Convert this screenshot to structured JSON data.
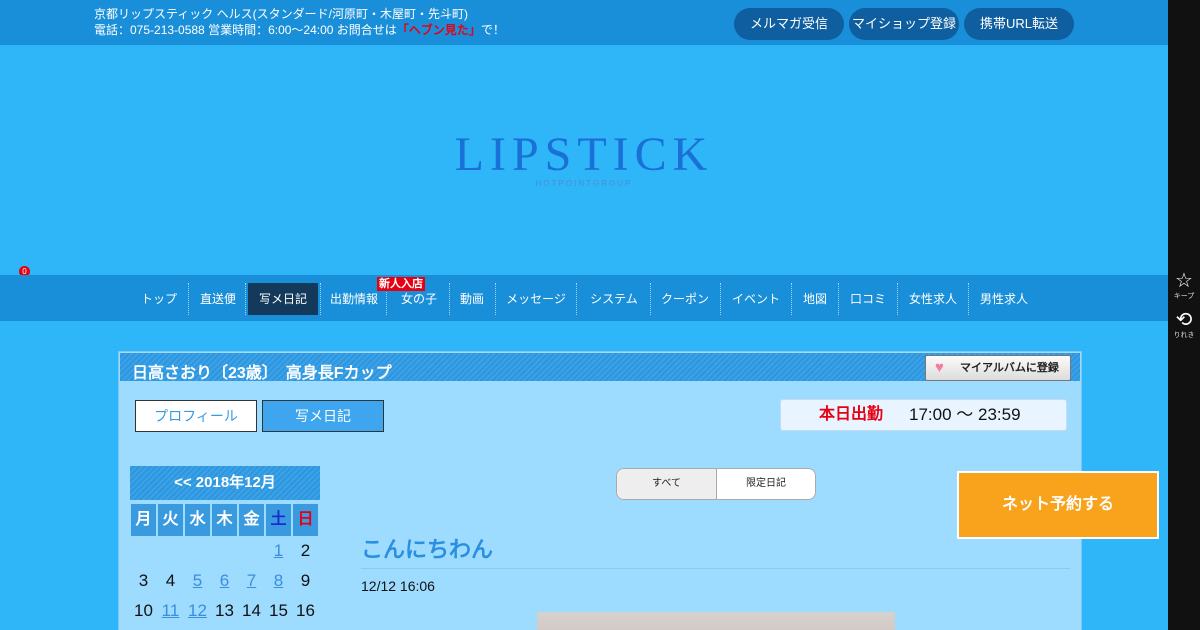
{
  "topbar": {
    "line1": "京都リップスティック ヘルス(スタンダード/河原町・木屋町・先斗町)",
    "line2_prefix": "電話：075-213-0588 営業時間：6:00～24:00 お問合せは",
    "line2_highlight": "「ヘブン見た」",
    "line2_suffix": "で！",
    "buttons": [
      "メルマガ受信",
      "マイショップ登録",
      "携帯URL転送"
    ]
  },
  "side": {
    "keep_label": "キープ",
    "keep_count": "0",
    "history_label": "りれき"
  },
  "logo": {
    "main": "LIPSTICK",
    "sub": "HOTPOINTGROUP"
  },
  "nav": {
    "items": [
      "トップ",
      "直送便",
      "写メ日記",
      "出勤情報",
      "女の子",
      "動画",
      "メッセージ",
      "システム",
      "クーポン",
      "イベント",
      "地図",
      "口コミ",
      "女性求人",
      "男性求人"
    ],
    "active": "写メ日記",
    "new_badge": "新人入店"
  },
  "profile": {
    "title": "日高さおり〔23歳〕　高身長Fカップ",
    "album_button": "マイアルバムに登録",
    "tabs": [
      "プロフィール",
      "写メ日記"
    ],
    "schedule_label": "本日出勤",
    "schedule_time": "17:00 ～ 23:59"
  },
  "calendar": {
    "header": "<< 2018年12月",
    "weekdays": [
      "月",
      "火",
      "水",
      "木",
      "金",
      "土",
      "日"
    ],
    "rows": [
      [
        "",
        "",
        "",
        "",
        "",
        "1",
        "2"
      ],
      [
        "3",
        "4",
        "5",
        "6",
        "7",
        "8",
        "9"
      ],
      [
        "10",
        "11",
        "12",
        "13",
        "14",
        "15",
        "16"
      ]
    ],
    "linked_days": [
      "1",
      "5",
      "6",
      "7",
      "8",
      "11",
      "12"
    ]
  },
  "diary": {
    "filter_all": "すべて",
    "filter_limited": "限定日記",
    "post_title": "こんにちわん",
    "post_date": "12/12 16:06"
  },
  "reserve_button": "ネット予約する",
  "colors": {
    "background": "#2eb6f8",
    "topbar": "#1a8fd9",
    "accent_red": "#e60012",
    "reserve_orange": "#f9a21c"
  }
}
